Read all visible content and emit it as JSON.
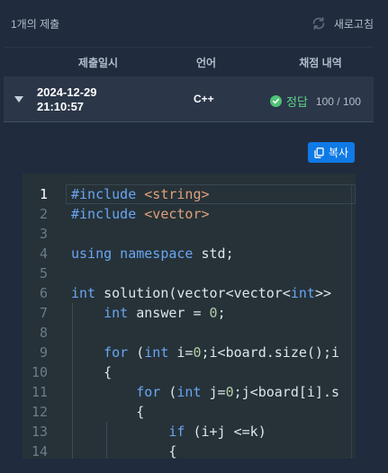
{
  "header": {
    "submission_count": "1개의 제출",
    "refresh_label": "새로고침"
  },
  "table": {
    "columns": [
      "제출일시",
      "언어",
      "채점 내역"
    ],
    "row": {
      "date": "2024-12-29",
      "time": "21:10:57",
      "language": "C++",
      "verdict": "정답",
      "score": "100 / 100"
    }
  },
  "copy_button": {
    "label": "복사"
  },
  "code": {
    "active_line": 1,
    "lines": [
      {
        "num": "1",
        "tokens": [
          [
            "k",
            "#include "
          ],
          [
            "s",
            "<string>"
          ]
        ]
      },
      {
        "num": "2",
        "tokens": [
          [
            "k",
            "#include "
          ],
          [
            "s",
            "<vector>"
          ]
        ]
      },
      {
        "num": "3",
        "tokens": []
      },
      {
        "num": "4",
        "tokens": [
          [
            "k",
            "using namespace "
          ],
          [
            "p",
            "std;"
          ]
        ]
      },
      {
        "num": "5",
        "tokens": []
      },
      {
        "num": "6",
        "tokens": [
          [
            "k",
            "int "
          ],
          [
            "p",
            "solution(vector<vector<"
          ],
          [
            "k",
            "int"
          ],
          [
            "p",
            ">>"
          ]
        ]
      },
      {
        "num": "7",
        "tokens": [
          [
            "p",
            "    "
          ],
          [
            "k",
            "int "
          ],
          [
            "p",
            "answer = "
          ],
          [
            "n",
            "0"
          ],
          [
            "p",
            ";"
          ]
        ]
      },
      {
        "num": "8",
        "tokens": []
      },
      {
        "num": "9",
        "tokens": [
          [
            "p",
            "    "
          ],
          [
            "k",
            "for "
          ],
          [
            "p",
            "("
          ],
          [
            "k",
            "int "
          ],
          [
            "p",
            "i="
          ],
          [
            "n",
            "0"
          ],
          [
            "p",
            ";i<board.size();i"
          ]
        ]
      },
      {
        "num": "10",
        "tokens": [
          [
            "p",
            "    {"
          ]
        ]
      },
      {
        "num": "11",
        "tokens": [
          [
            "p",
            "        "
          ],
          [
            "k",
            "for "
          ],
          [
            "p",
            "("
          ],
          [
            "k",
            "int "
          ],
          [
            "p",
            "j="
          ],
          [
            "n",
            "0"
          ],
          [
            "p",
            ";j<board[i].s"
          ]
        ]
      },
      {
        "num": "12",
        "tokens": [
          [
            "p",
            "        {"
          ]
        ]
      },
      {
        "num": "13",
        "tokens": [
          [
            "p",
            "            "
          ],
          [
            "k",
            "if "
          ],
          [
            "p",
            "(i+j <=k)"
          ]
        ]
      },
      {
        "num": "14",
        "tokens": [
          [
            "p",
            "            {"
          ]
        ]
      }
    ]
  },
  "colors": {
    "background": "#202b3d",
    "row_background": "#2b3649",
    "editor_background": "#263238",
    "accent": "#0f7ae5",
    "success": "#4fc276",
    "keyword": "#6aa5f2",
    "string": "#e0a079",
    "number": "#b5cea8"
  },
  "icons": [
    "refresh-icon",
    "expand-caret-icon",
    "check-circle-icon",
    "copy-icon"
  ]
}
